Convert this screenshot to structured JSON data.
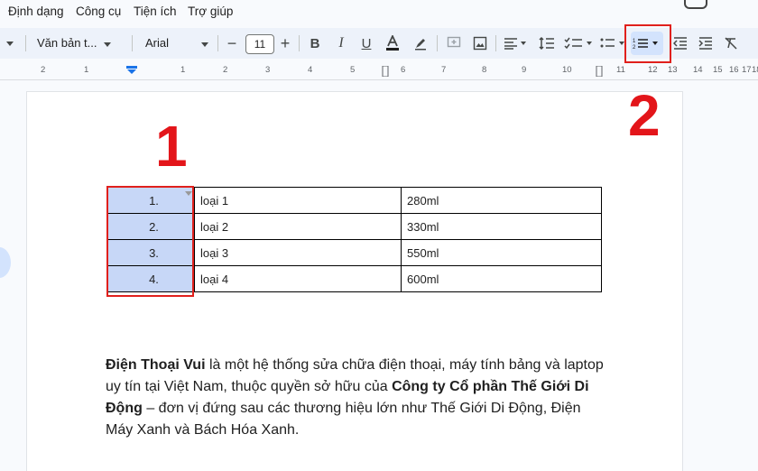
{
  "menu": [
    "Định dạng",
    "Công cụ",
    "Tiện ích",
    "Trợ giúp"
  ],
  "toolbar": {
    "style_label": "Văn bản t...",
    "font_label": "Arial",
    "font_size": "11"
  },
  "ruler": [
    "2",
    "1",
    "1",
    "2",
    "3",
    "4",
    "5",
    "6",
    "7",
    "8",
    "9",
    "10",
    "11",
    "12",
    "13",
    "14",
    "15",
    "16",
    "17",
    "18"
  ],
  "table": {
    "rows": [
      {
        "num": "1.",
        "name": "loại 1",
        "volume": "280ml"
      },
      {
        "num": "2.",
        "name": "loại 2",
        "volume": "330ml"
      },
      {
        "num": "3.",
        "name": "loại 3",
        "volume": "550ml"
      },
      {
        "num": "4.",
        "name": "loại 4",
        "volume": "600ml"
      }
    ]
  },
  "annotations": {
    "one": "1",
    "two": "2"
  },
  "paragraph": {
    "bold1": "Điện Thoại Vui",
    "text1": " là một hệ thống sửa chữa điện thoại, máy tính bảng và laptop uy tín tại Việt Nam, thuộc quyền sở hữu của ",
    "bold2": "Công ty Cổ phần Thế Giới Di Động",
    "text2": " – đơn vị đứng sau các thương hiệu lớn như Thế Giới Di Động, Điện Máy Xanh và Bách Hóa Xanh."
  },
  "colors": {
    "highlight": "#c7d7f7",
    "annotation_red": "#e3151a"
  }
}
